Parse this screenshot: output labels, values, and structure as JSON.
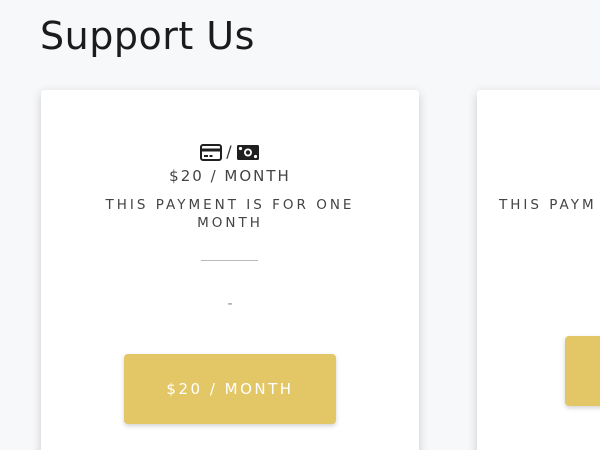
{
  "page": {
    "title": "Support Us"
  },
  "plans": [
    {
      "payment_icons": [
        "credit-card-icon",
        "cash-icon"
      ],
      "separator": "/",
      "price": "$20 / MONTH",
      "description": "THIS PAYMENT IS FOR ONE MONTH",
      "note": "-",
      "button_label": "$20 / MONTH"
    },
    {
      "description": "THIS PAYM"
    }
  ],
  "colors": {
    "background": "#f7f8fa",
    "card": "#ffffff",
    "accent": "#e3c666",
    "button_text": "#ffffff"
  }
}
